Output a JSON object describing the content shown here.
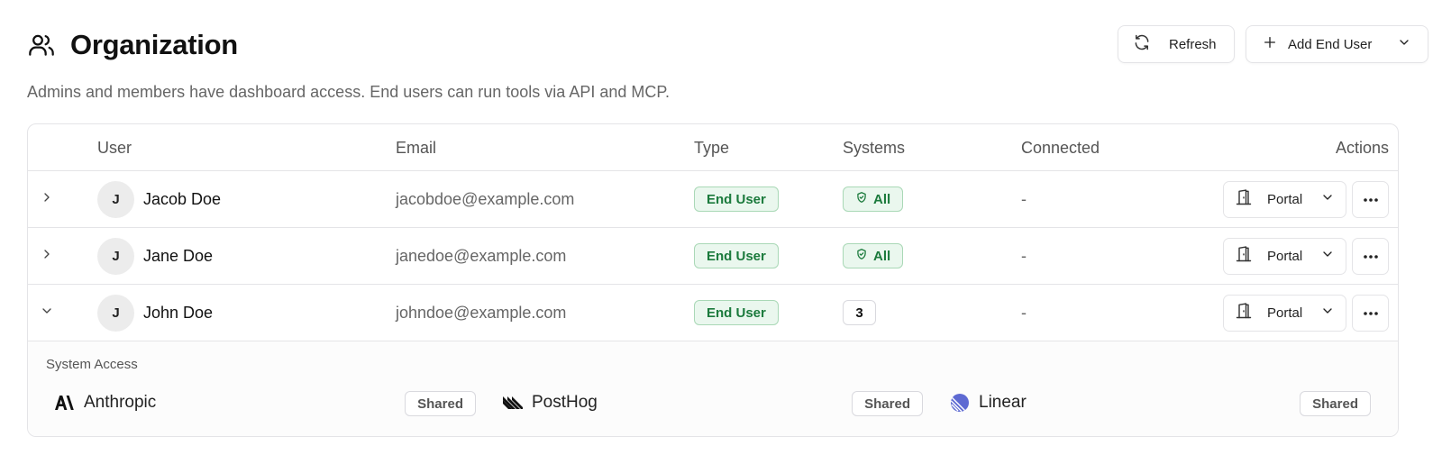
{
  "header": {
    "title": "Organization",
    "icon": "users-icon",
    "subtitle": "Admins and members have dashboard access. End users can run tools via API and MCP.",
    "refresh_label": "Refresh",
    "add_label": "Add End User"
  },
  "table": {
    "columns": {
      "user": "User",
      "email": "Email",
      "type": "Type",
      "systems": "Systems",
      "connected": "Connected",
      "actions": "Actions"
    },
    "rows": [
      {
        "initial": "J",
        "name": "Jacob Doe",
        "email": "jacobdoe@example.com",
        "type": "End User",
        "systems": "All",
        "connected": "-",
        "portal": "Portal",
        "expanded": false
      },
      {
        "initial": "J",
        "name": "Jane Doe",
        "email": "janedoe@example.com",
        "type": "End User",
        "systems": "All",
        "connected": "-",
        "portal": "Portal",
        "expanded": false
      },
      {
        "initial": "J",
        "name": "John Doe",
        "email": "johndoe@example.com",
        "type": "End User",
        "systems": "3",
        "connected": "-",
        "portal": "Portal",
        "expanded": true
      }
    ]
  },
  "system_access": {
    "title": "System Access",
    "systems": [
      {
        "name": "Anthropic",
        "status": "Shared",
        "icon": "anthropic-logo"
      },
      {
        "name": "PostHog",
        "status": "Shared",
        "icon": "posthog-logo"
      },
      {
        "name": "Linear",
        "status": "Shared",
        "icon": "linear-logo"
      }
    ]
  },
  "colors": {
    "green_text": "#1b7a3c",
    "green_bg": "#eaf7ee",
    "green_border": "#a9d8b6",
    "linear": "#5e6ad2"
  }
}
